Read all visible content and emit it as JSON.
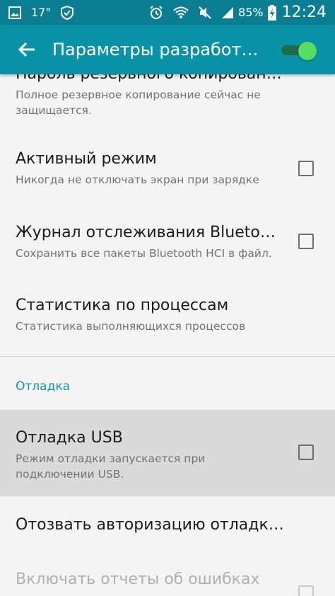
{
  "status_bar": {
    "temperature": "17°",
    "battery": "85%",
    "time": "12:24",
    "icons": [
      "image-icon",
      "shield-icon",
      "alarm-icon",
      "wifi-icon",
      "mute-icon",
      "signal-icon",
      "battery-charging-icon"
    ]
  },
  "toolbar": {
    "title": "Параметры разработч...",
    "switch_on": true,
    "accent": "#0a93a8"
  },
  "items": [
    {
      "title": "Пароль резервного копирования",
      "subtitle": "Полное резервное копирование сейчас не защищается."
    },
    {
      "title": "Активный режим",
      "subtitle": "Никогда не отключать экран при зарядке",
      "checked": false
    },
    {
      "title": "Журнал отслеживания Bluetoot...",
      "subtitle": "Сохранить все пакеты Bluetooth HCI в файл.",
      "checked": false
    },
    {
      "title": "Статистика по процессам",
      "subtitle": "Статистика выполняющихся процессов"
    },
    {
      "title": "Отладка USB",
      "subtitle": "Режим отладки запускается при подключении USB.",
      "checked": false
    },
    {
      "title": "Отозвать авторизацию отладки U...",
      "subtitle": ""
    },
    {
      "title": "Включать отчеты об ошибках",
      "subtitle": "",
      "checked": false
    }
  ],
  "section": {
    "label": "Отладка"
  }
}
